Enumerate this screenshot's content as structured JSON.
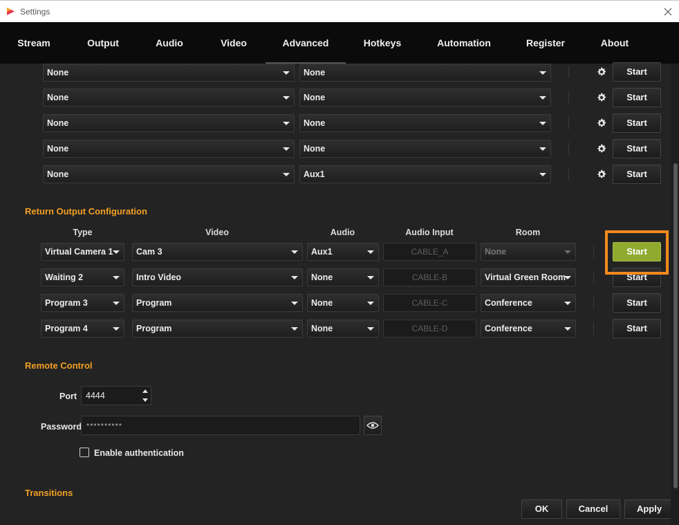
{
  "window": {
    "title": "Settings"
  },
  "tabs": [
    "Stream",
    "Output",
    "Audio",
    "Video",
    "Advanced",
    "Hotkeys",
    "Automation",
    "Register",
    "About"
  ],
  "active_tab": "Advanced",
  "output_rows": [
    {
      "source": "None",
      "audio": "None",
      "button": "Start"
    },
    {
      "source": "None",
      "audio": "None",
      "button": "Start"
    },
    {
      "source": "None",
      "audio": "None",
      "button": "Start"
    },
    {
      "source": "None",
      "audio": "None",
      "button": "Start"
    },
    {
      "source": "None",
      "audio": "Aux1",
      "button": "Start"
    }
  ],
  "return_output": {
    "title": "Return Output Configuration",
    "headers": {
      "type": "Type",
      "video": "Video",
      "audio": "Audio",
      "audio_input": "Audio Input",
      "room": "Room"
    },
    "rows": [
      {
        "type": "Virtual Camera 1",
        "video": "Cam 3",
        "audio": "Aux1",
        "audio_input": "CABLE_A",
        "room": "None",
        "button": "Start"
      },
      {
        "type": "Waiting 2",
        "video": "Intro Video",
        "audio": "None",
        "audio_input": "CABLE-B",
        "room": "Virtual Green Room",
        "button": "Start"
      },
      {
        "type": "Program 3",
        "video": "Program",
        "audio": "None",
        "audio_input": "CABLE-C",
        "room": "Conference",
        "button": "Start"
      },
      {
        "type": "Program 4",
        "video": "Program",
        "audio": "None",
        "audio_input": "CABLE-D",
        "room": "Conference",
        "button": "Start"
      }
    ]
  },
  "remote_control": {
    "title": "Remote Control",
    "port_label": "Port",
    "port_value": "4444",
    "password_label": "Password",
    "password_value": "••••••••••",
    "auth_label": "Enable authentication"
  },
  "transitions": {
    "title": "Transitions"
  },
  "footer": {
    "ok": "OK",
    "cancel": "Cancel",
    "apply": "Apply"
  },
  "colors": {
    "accent": "#f2a024",
    "active_button": "#8faa2f",
    "highlight": "#f28a1e"
  }
}
